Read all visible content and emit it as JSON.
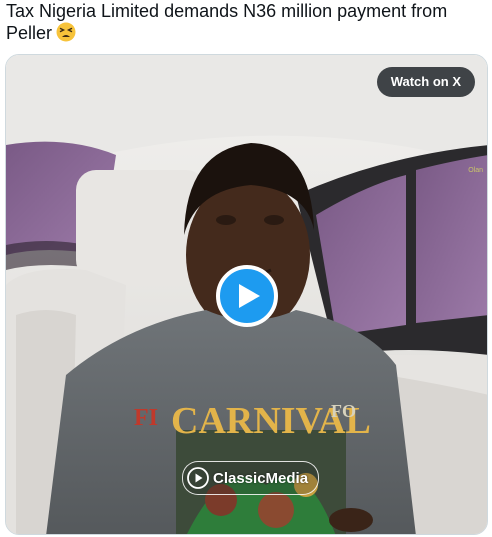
{
  "tweet": {
    "text": "Tax Nigeria Limited demands N36 million payment from Peller",
    "emoji": "tired-face-emoji"
  },
  "media": {
    "watch_label": "Watch on X",
    "play_icon": "play-icon",
    "watermark_text": "ClassicMedia",
    "corner_text": "Olan",
    "shirt_text_main": "CARNIVAL",
    "shirt_text_left": "FI",
    "shirt_text_right": "FO",
    "accent_color": "#1d9bf0"
  }
}
